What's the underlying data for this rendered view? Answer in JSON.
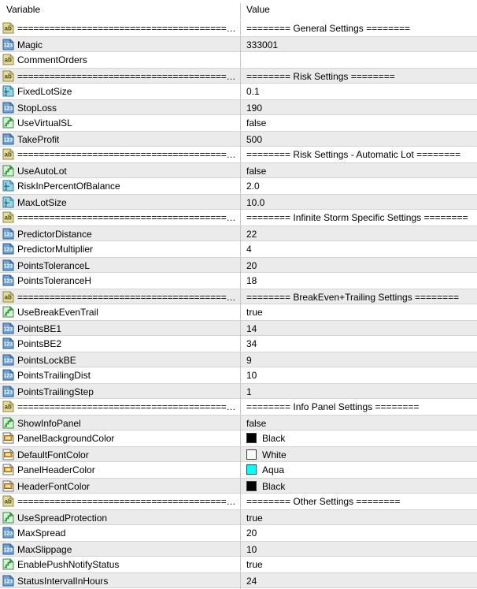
{
  "header": {
    "variable_column": "Variable",
    "value_column": "Value"
  },
  "colors": {
    "row_alt_background": "#ebebeb",
    "row_background": "#ffffff",
    "grid_line": "#d5d5d5",
    "divider": "#c8c8c8",
    "text": "#000000",
    "icon_string": "#d8cf8a",
    "icon_int": "#6a9fd8",
    "icon_double": "#7fc9e0",
    "icon_bool": "#35b14a",
    "icon_color": "#f0a020"
  },
  "rows": [
    {
      "icon": "string-type-icon",
      "variable": "========================================...",
      "value": "======== General Settings ========"
    },
    {
      "icon": "int-type-icon",
      "variable": "Magic",
      "value": "333001"
    },
    {
      "icon": "string-type-icon",
      "variable": "CommentOrders",
      "value": ""
    },
    {
      "icon": "string-type-icon",
      "variable": "========================================...",
      "value": "======== Risk Settings ========"
    },
    {
      "icon": "double-type-icon",
      "variable": "FixedLotSize",
      "value": "0.1"
    },
    {
      "icon": "int-type-icon",
      "variable": "StopLoss",
      "value": "190"
    },
    {
      "icon": "bool-type-icon",
      "variable": "UseVirtualSL",
      "value": "false"
    },
    {
      "icon": "int-type-icon",
      "variable": "TakeProfit",
      "value": "500"
    },
    {
      "icon": "string-type-icon",
      "variable": "========================================...",
      "value": "======== Risk Settings - Automatic Lot ========"
    },
    {
      "icon": "bool-type-icon",
      "variable": "UseAutoLot",
      "value": "false"
    },
    {
      "icon": "double-type-icon",
      "variable": "RiskInPercentOfBalance",
      "value": "2.0"
    },
    {
      "icon": "double-type-icon",
      "variable": "MaxLotSize",
      "value": "10.0"
    },
    {
      "icon": "string-type-icon",
      "variable": "========================================...",
      "value": "======== Infinite Storm Specific Settings ========"
    },
    {
      "icon": "int-type-icon",
      "variable": "PredictorDistance",
      "value": "22"
    },
    {
      "icon": "int-type-icon",
      "variable": "PredictorMultiplier",
      "value": "4"
    },
    {
      "icon": "int-type-icon",
      "variable": "PointsToleranceL",
      "value": "20"
    },
    {
      "icon": "int-type-icon",
      "variable": "PointsToleranceH",
      "value": "18"
    },
    {
      "icon": "string-type-icon",
      "variable": "========================================...",
      "value": "======== BreakEven+Trailing Settings ========"
    },
    {
      "icon": "bool-type-icon",
      "variable": "UseBreakEvenTrail",
      "value": "true"
    },
    {
      "icon": "int-type-icon",
      "variable": "PointsBE1",
      "value": "14"
    },
    {
      "icon": "int-type-icon",
      "variable": "PointsBE2",
      "value": "34"
    },
    {
      "icon": "int-type-icon",
      "variable": "PointsLockBE",
      "value": "9"
    },
    {
      "icon": "int-type-icon",
      "variable": "PointsTrailingDist",
      "value": "10"
    },
    {
      "icon": "int-type-icon",
      "variable": "PointsTrailingStep",
      "value": "1"
    },
    {
      "icon": "string-type-icon",
      "variable": "========================================...",
      "value": "======== Info Panel Settings ========"
    },
    {
      "icon": "bool-type-icon",
      "variable": "ShowInfoPanel",
      "value": "false"
    },
    {
      "icon": "color-type-icon",
      "variable": "PanelBackgroundColor",
      "value": "Black",
      "swatch": "#000000"
    },
    {
      "icon": "color-type-icon",
      "variable": "DefaultFontColor",
      "value": "White",
      "swatch": "#ffffff"
    },
    {
      "icon": "color-type-icon",
      "variable": "PanelHeaderColor",
      "value": "Aqua",
      "swatch": "#00ffff"
    },
    {
      "icon": "color-type-icon",
      "variable": "HeaderFontColor",
      "value": "Black",
      "swatch": "#000000"
    },
    {
      "icon": "string-type-icon",
      "variable": "========================================...",
      "value": "======== Other Settings ========"
    },
    {
      "icon": "bool-type-icon",
      "variable": "UseSpreadProtection",
      "value": "true"
    },
    {
      "icon": "int-type-icon",
      "variable": "MaxSpread",
      "value": "20"
    },
    {
      "icon": "int-type-icon",
      "variable": "MaxSlippage",
      "value": "10"
    },
    {
      "icon": "bool-type-icon",
      "variable": "EnablePushNotifyStatus",
      "value": "true"
    },
    {
      "icon": "int-type-icon",
      "variable": "StatusIntervalInHours",
      "value": "24"
    }
  ]
}
